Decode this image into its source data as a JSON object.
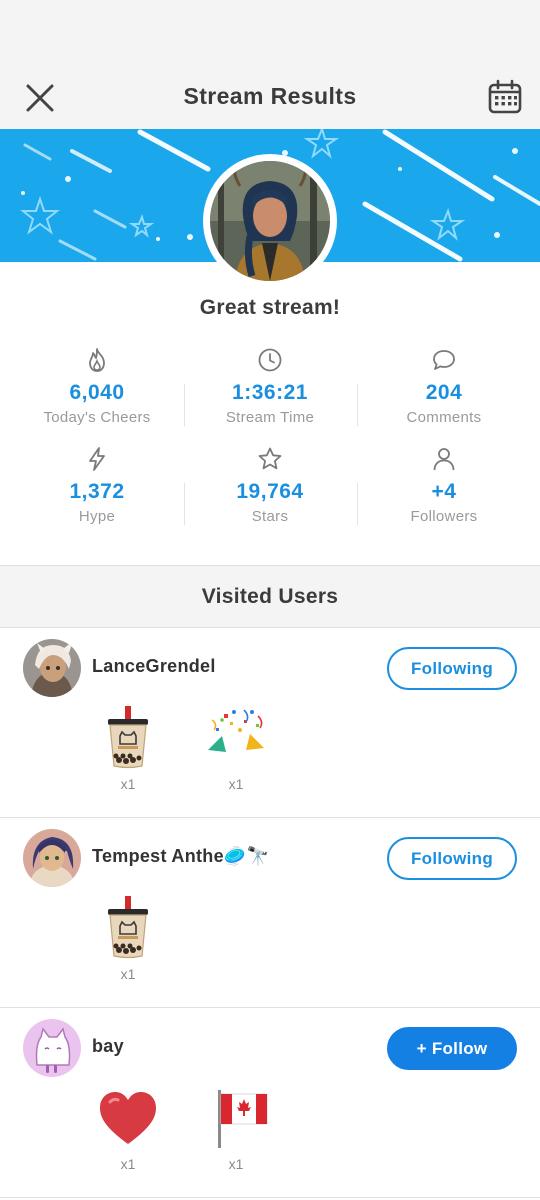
{
  "header": {
    "title": "Stream Results",
    "close_icon": "close-icon",
    "calendar_icon": "calendar-icon"
  },
  "banner": {
    "color": "#1aa7ec"
  },
  "summary": {
    "message": "Great stream!"
  },
  "stats": [
    {
      "icon": "flame-icon",
      "value": "6,040",
      "label": "Today's Cheers"
    },
    {
      "icon": "clock-icon",
      "value": "1:36:21",
      "label": "Stream Time"
    },
    {
      "icon": "comment-icon",
      "value": "204",
      "label": "Comments"
    },
    {
      "icon": "lightning-icon",
      "value": "1,372",
      "label": "Hype"
    },
    {
      "icon": "star-icon",
      "value": "19,764",
      "label": "Stars"
    },
    {
      "icon": "person-icon",
      "value": "+4",
      "label": "Followers"
    }
  ],
  "visited": {
    "title": "Visited Users",
    "users": [
      {
        "name": "LanceGrendel",
        "button": "Following",
        "gifts": [
          {
            "icon": "bubble-tea-icon",
            "count": "x1"
          },
          {
            "icon": "party-popper-icon",
            "count": "x1"
          }
        ]
      },
      {
        "name": "Tempest Anthe🥏🔭",
        "button": "Following",
        "gifts": [
          {
            "icon": "bubble-tea-icon",
            "count": "x1"
          }
        ]
      },
      {
        "name": "bay",
        "button": "+ Follow",
        "gifts": [
          {
            "icon": "heart-icon",
            "count": "x1"
          },
          {
            "icon": "canada-flag-icon",
            "count": "x1"
          }
        ]
      }
    ]
  },
  "colors": {
    "accent": "#1a8fe0",
    "follow_button": "#1580e3"
  }
}
